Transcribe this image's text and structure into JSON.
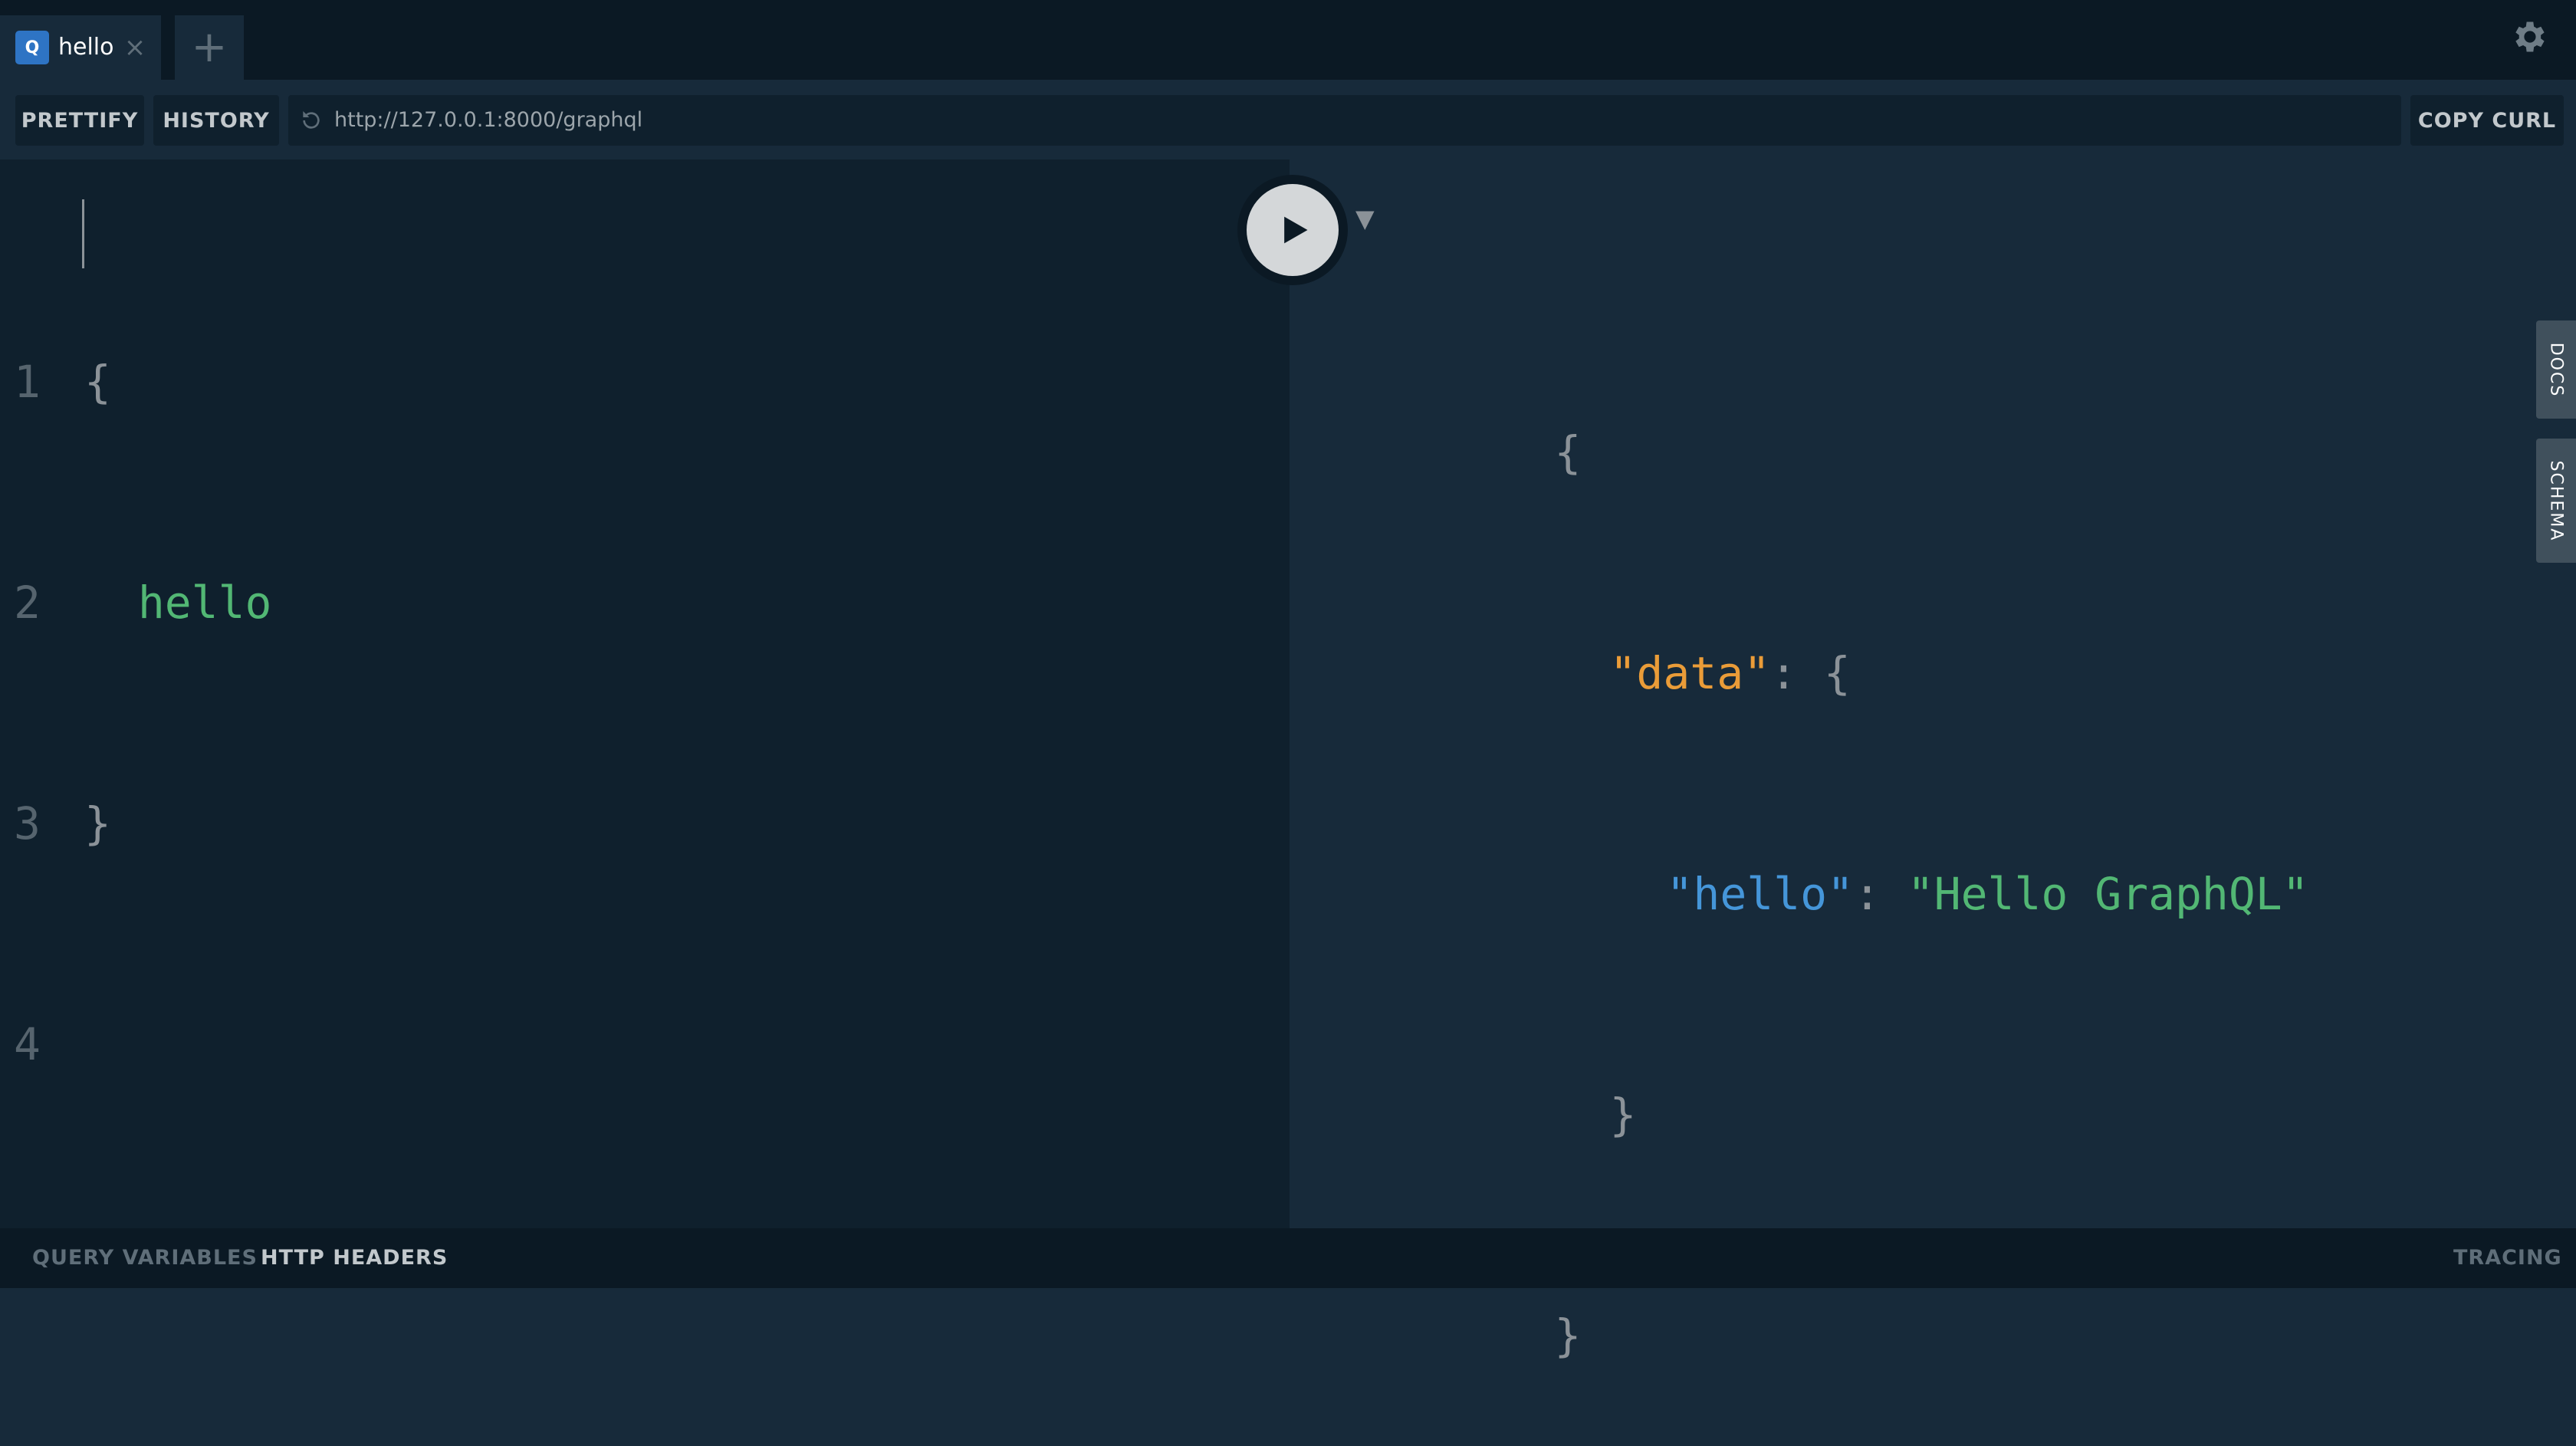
{
  "tabbar": {
    "tab": {
      "badge": "Q",
      "label": "hello",
      "close": "×"
    },
    "add": "+"
  },
  "toolbar": {
    "prettify": "PRETTIFY",
    "history": "HISTORY",
    "url": "http://127.0.0.1:8000/graphql",
    "copy_curl": "COPY CURL"
  },
  "query_editor": {
    "line_numbers": [
      "1",
      "2",
      "3",
      "4"
    ],
    "lines": [
      "{",
      "  hello",
      "}",
      ""
    ]
  },
  "result_viewer": {
    "open_brace": "{",
    "data_key": "\"data\"",
    "colon": ": ",
    "inner_open": "{",
    "hello_key": "\"hello\"",
    "hello_value": "\"Hello GraphQL\"",
    "inner_close": "}",
    "close_brace": "}",
    "fold_toggle": "▼"
  },
  "side_tabs": {
    "docs": "DOCS",
    "schema": "SCHEMA"
  },
  "bottombar": {
    "query_variables": "QUERY VARIABLES",
    "http_headers": "HTTP HEADERS",
    "tracing": "TRACING"
  },
  "colors": {
    "background": "#172a3a",
    "editor_bg": "#0f202d",
    "chrome_bg": "#0b1924",
    "field": "#52b774",
    "key": "#ea9c38",
    "key_nested": "#4596d9",
    "string": "#52b774",
    "tab_badge": "#2e74c4"
  },
  "icons": {
    "settings": "gear-icon",
    "reload": "reload-icon",
    "run": "play-icon",
    "fold": "triangle-down-icon"
  }
}
